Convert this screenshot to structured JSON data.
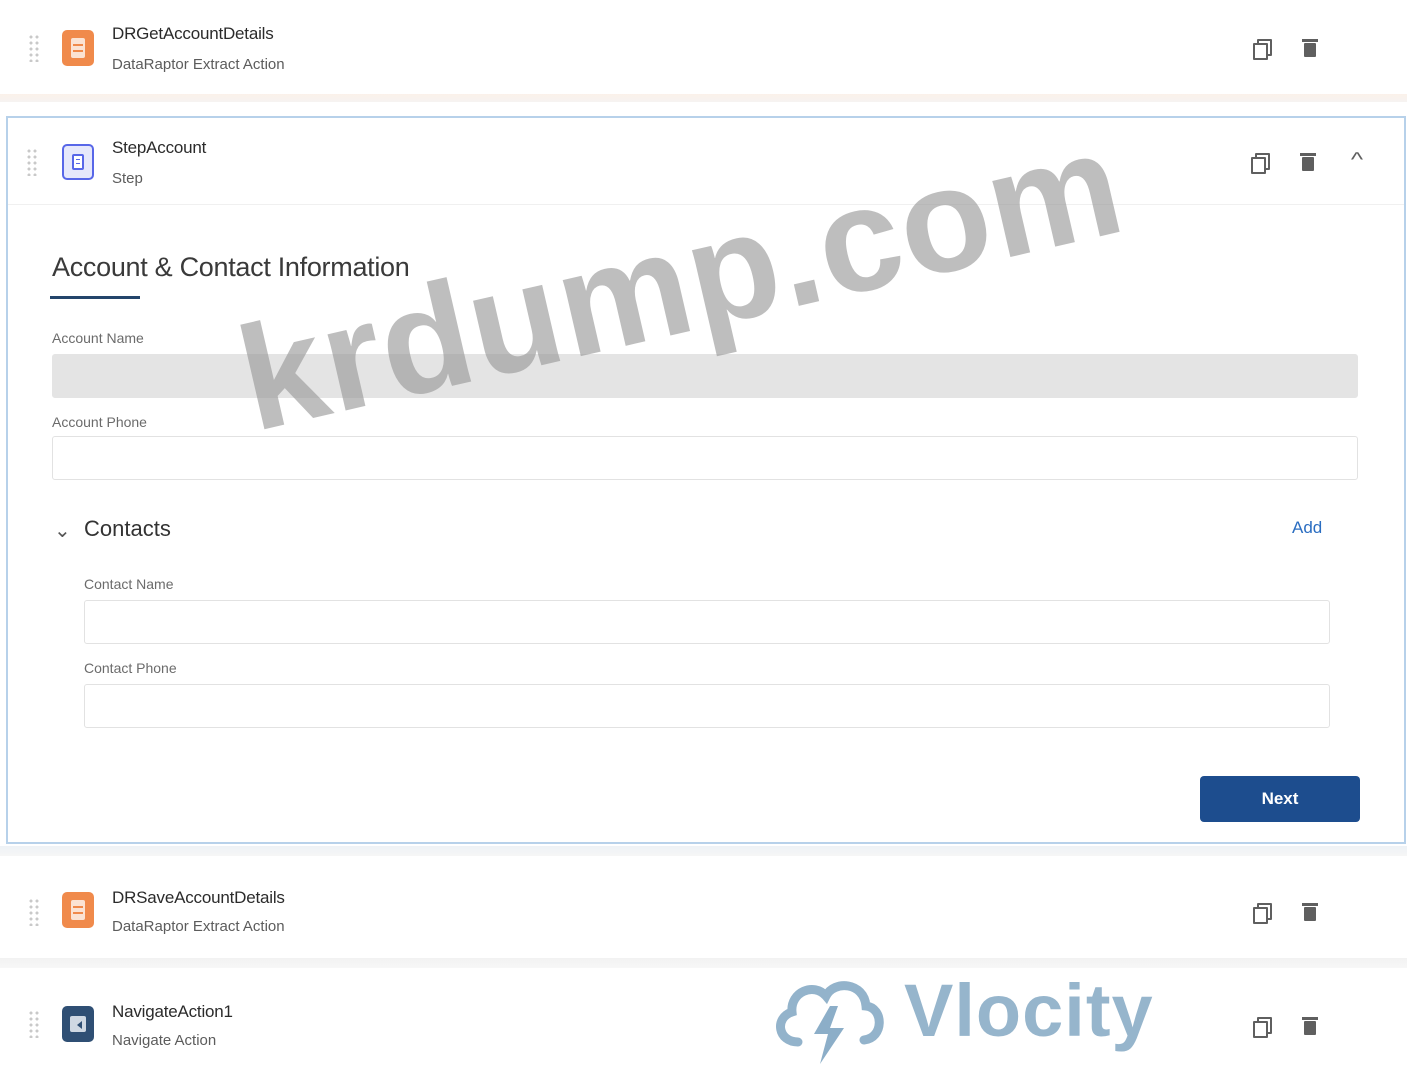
{
  "elements": [
    {
      "name": "DRGetAccountDetails",
      "type": "DataRaptor Extract Action",
      "icon": "dataraptor-icon"
    },
    {
      "name": "StepAccount",
      "type": "Step",
      "icon": "step-icon"
    },
    {
      "name": "DRSaveAccountDetails",
      "type": "DataRaptor Extract Action",
      "icon": "dataraptor-icon"
    },
    {
      "name": "NavigateAction1",
      "type": "Navigate Action",
      "icon": "navigate-icon"
    }
  ],
  "step": {
    "title": "Account & Contact Information",
    "fields": {
      "account_name": {
        "label": "Account Name",
        "value": ""
      },
      "account_phone": {
        "label": "Account Phone",
        "value": ""
      }
    },
    "contacts": {
      "title": "Contacts",
      "add_label": "Add",
      "contact_name": {
        "label": "Contact Name",
        "value": ""
      },
      "contact_phone": {
        "label": "Contact Phone",
        "value": ""
      }
    },
    "next_label": "Next"
  },
  "watermarks": {
    "site": "krdump.com",
    "brand": "Vlocity"
  },
  "colors": {
    "dataraptor_icon": "#f08a4b",
    "step_icon": "#5867e8",
    "navigate_icon": "#2f4f74",
    "next_button": "#1d4d8e",
    "add_link": "#2a6dc1",
    "active_border": "#b7d1ea"
  }
}
